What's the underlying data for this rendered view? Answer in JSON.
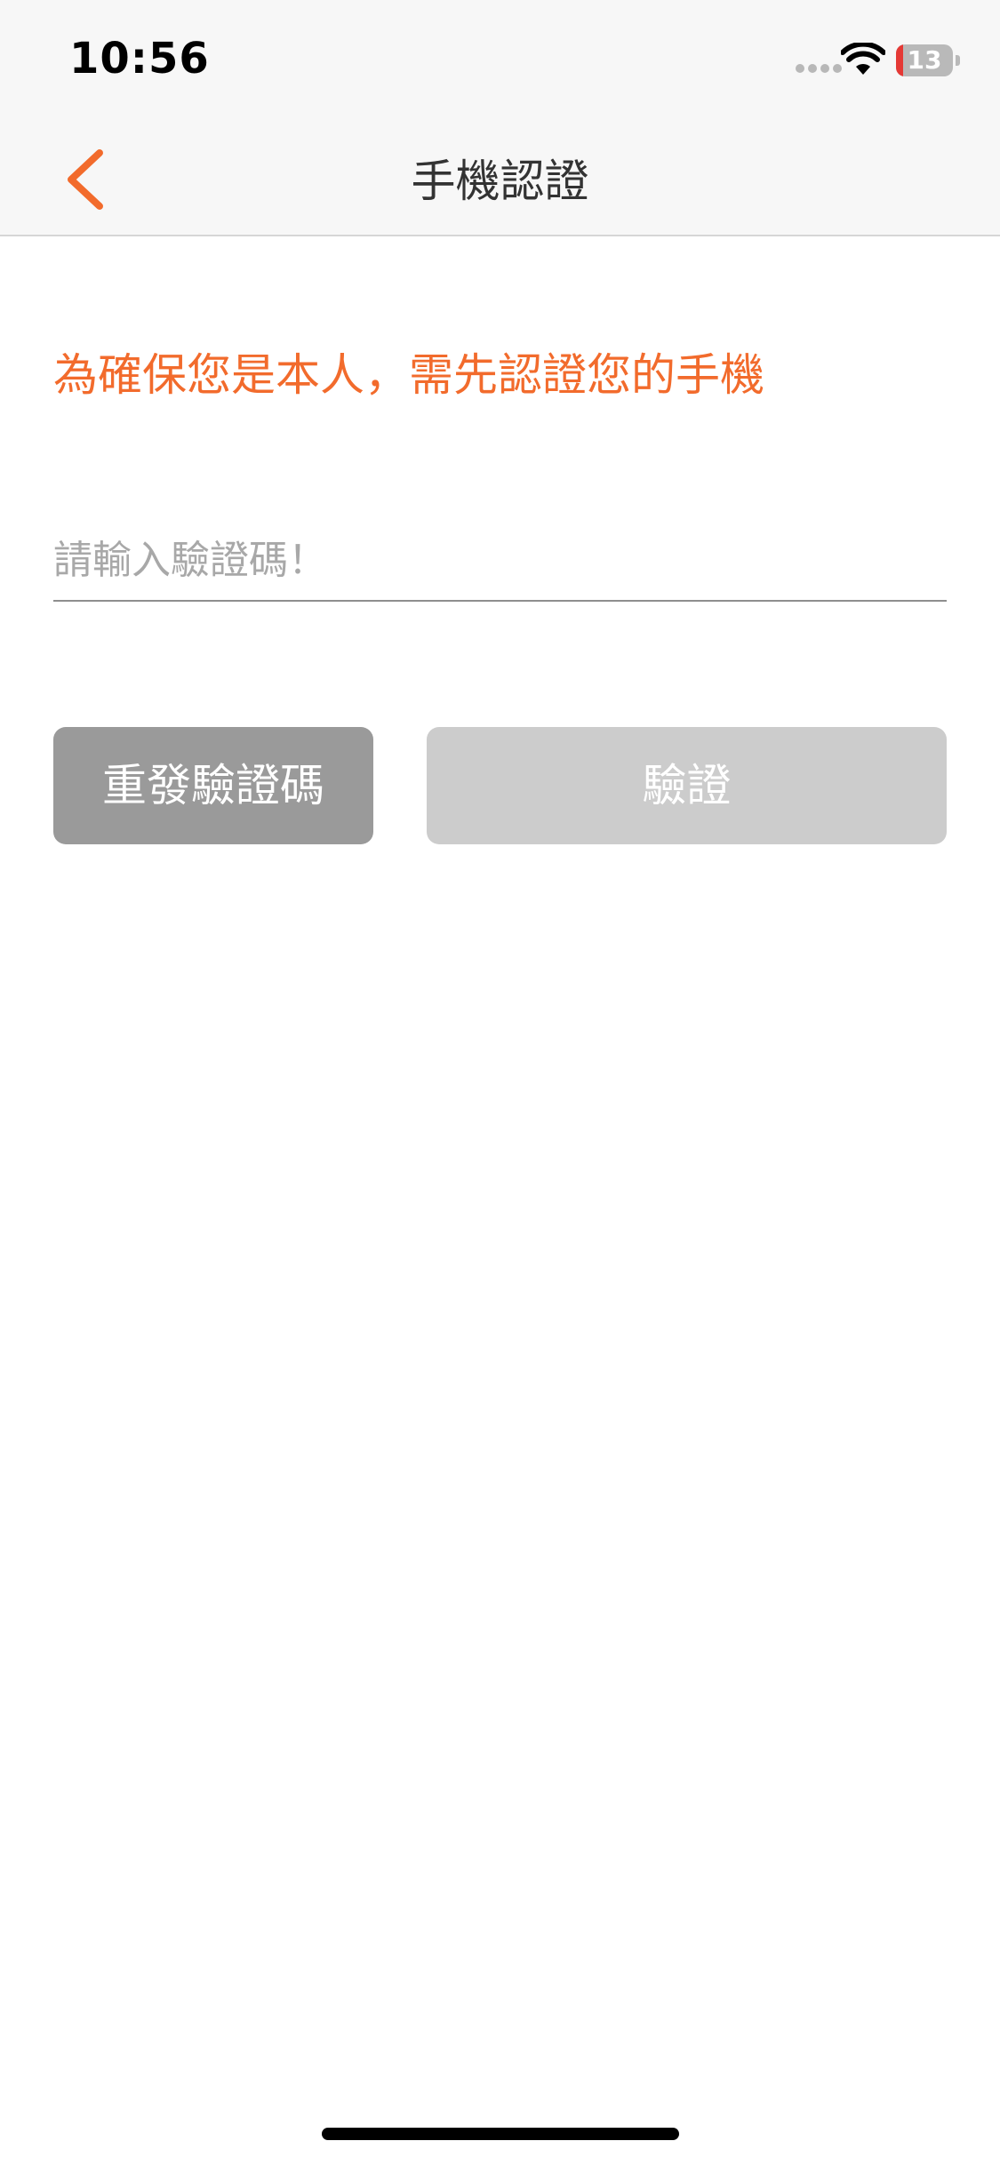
{
  "status_bar": {
    "time": "10:56",
    "battery_level": "13",
    "battery_fraction": 0.13,
    "icons": [
      "signal-dots-icon",
      "wifi-icon",
      "battery-icon"
    ]
  },
  "nav": {
    "title": "手機認證",
    "back_icon": "chevron-left-icon"
  },
  "main": {
    "notice": "為確保您是本人，需先認證您的手機",
    "code_input": {
      "value": "",
      "placeholder": "請輸入驗證碼！"
    },
    "resend_label": "重發驗證碼",
    "verify_label": "驗證"
  },
  "colors": {
    "accent": "#F26B2C",
    "resend_button_bg": "#9A9A9A",
    "verify_button_bg": "#CCCCCC",
    "bar_bg": "#F7F7F7",
    "battery_low": "#E53935"
  }
}
